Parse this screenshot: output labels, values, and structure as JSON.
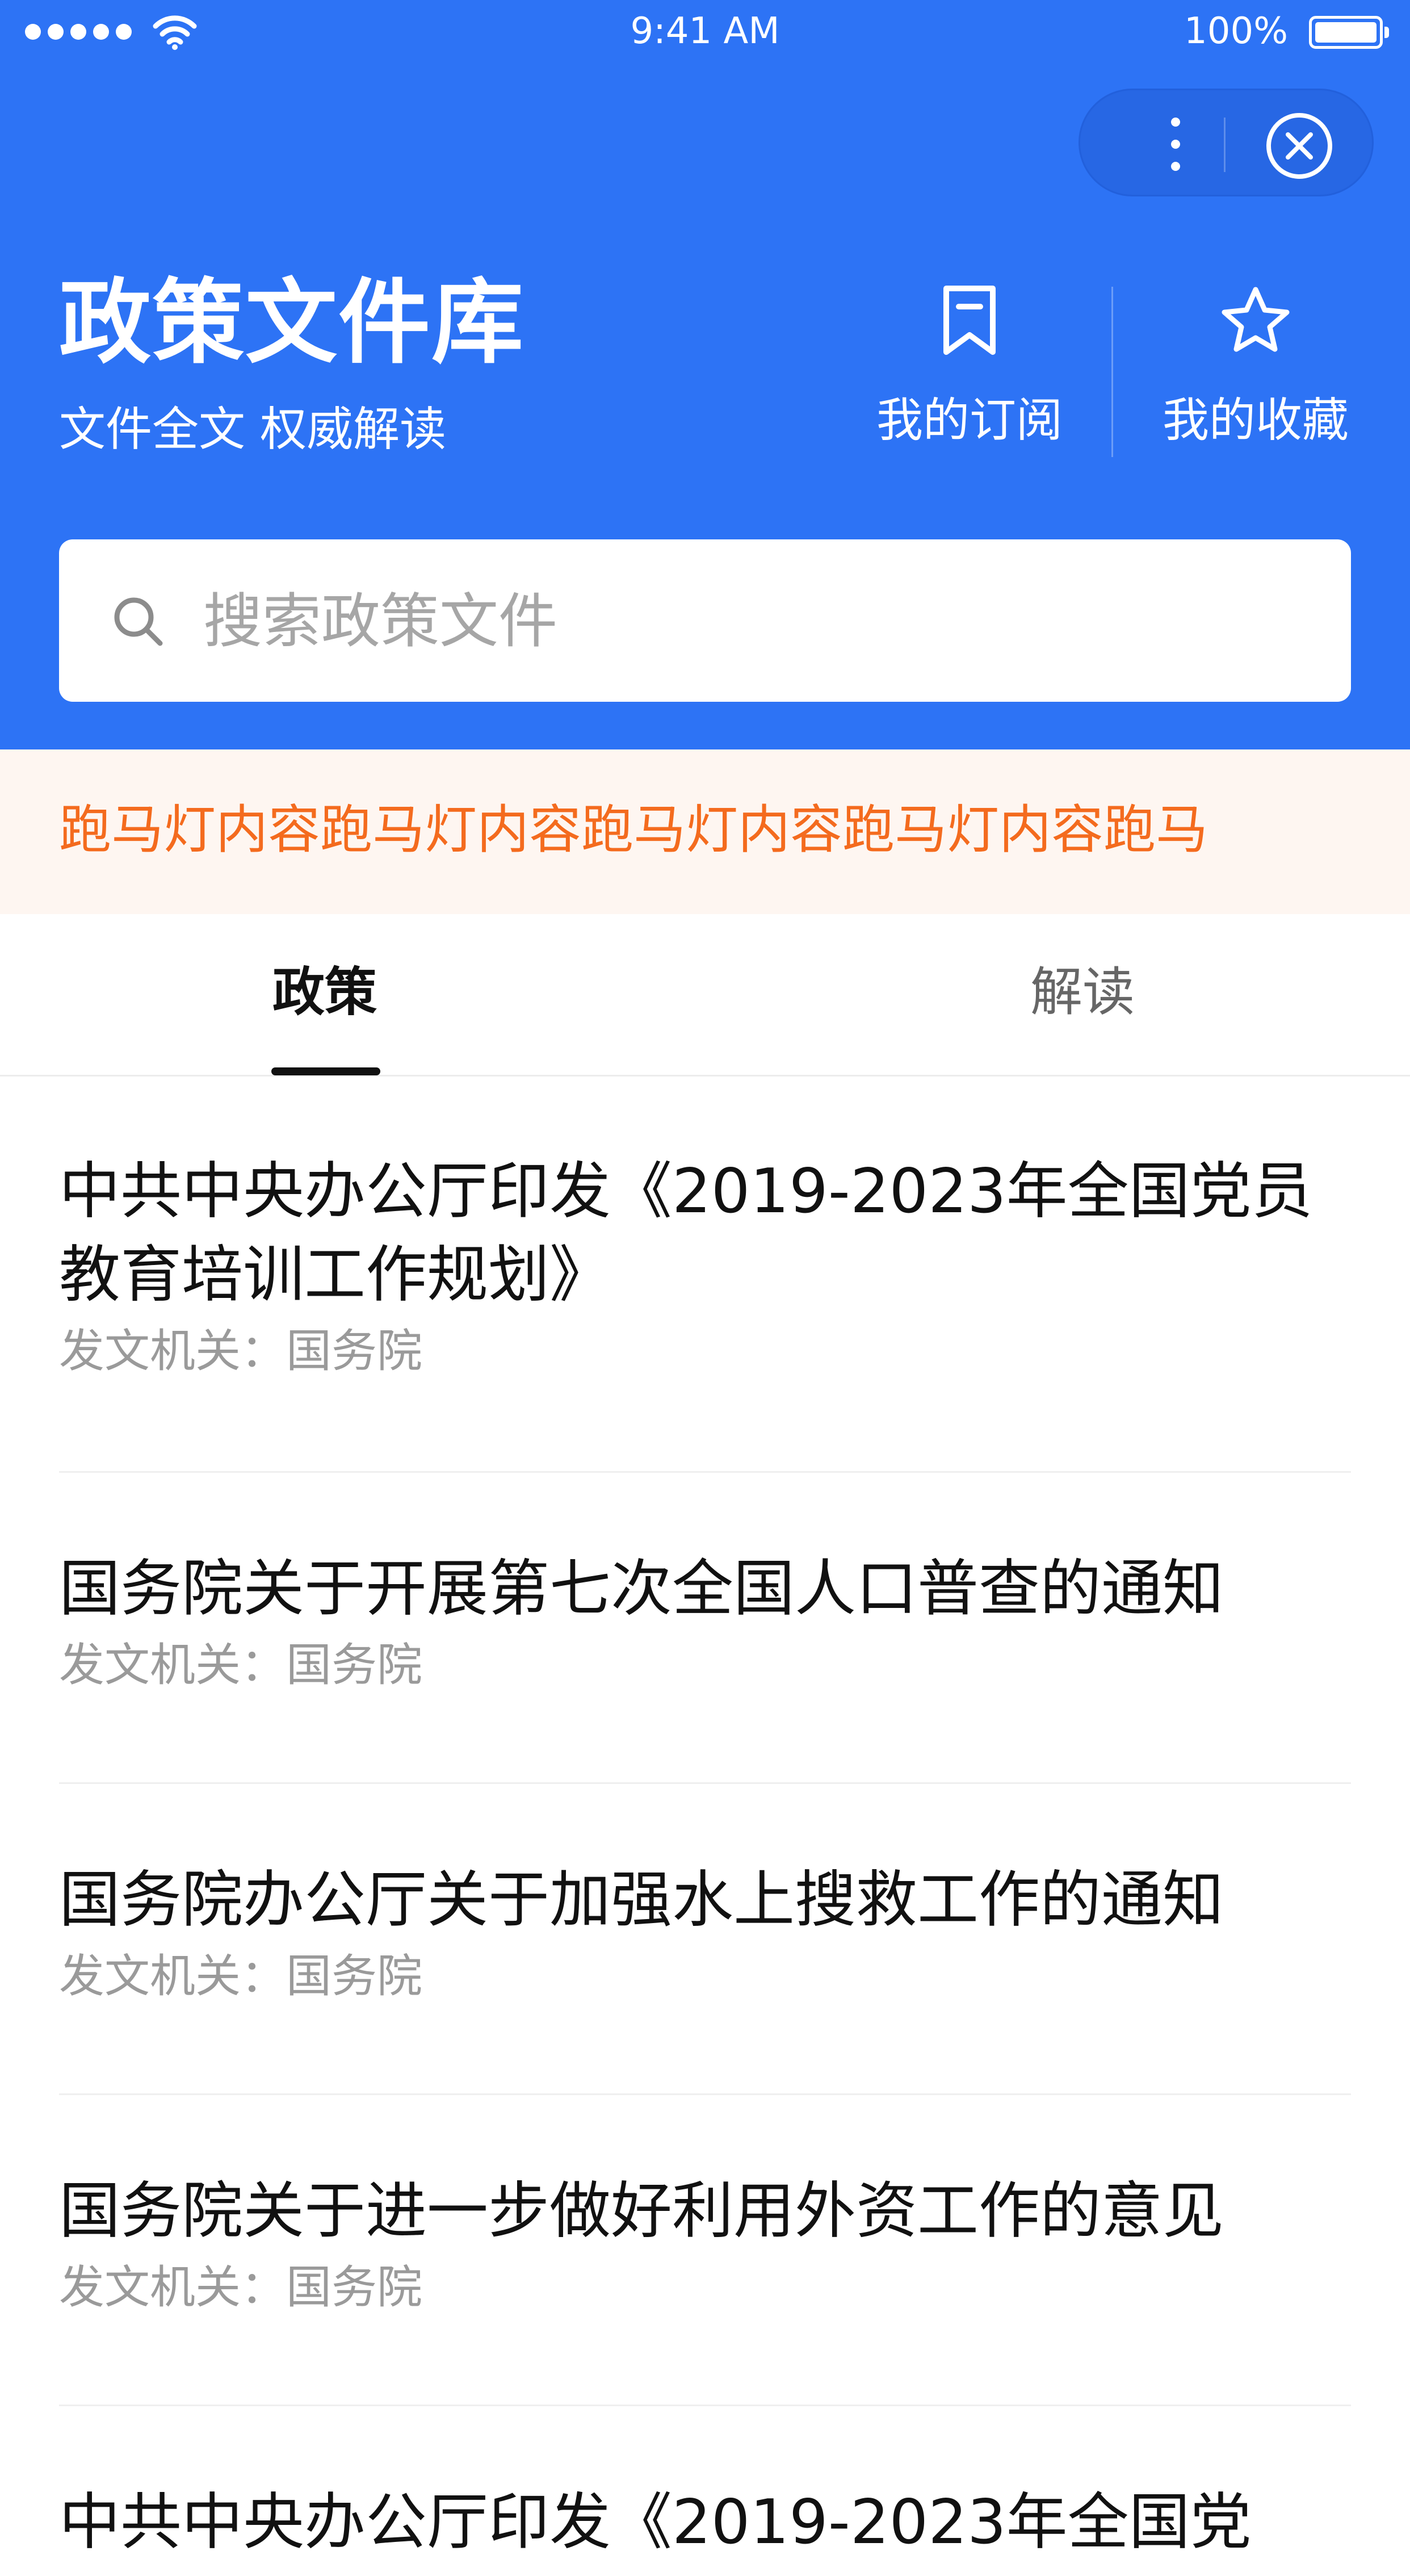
{
  "status_bar": {
    "time": "9:41 AM",
    "battery": "100%"
  },
  "header": {
    "title": "政策文件库",
    "subtitle": "文件全文 权威解读",
    "subscribe_label": "我的订阅",
    "favorites_label": "我的收藏",
    "brand_color": "#2d73f5"
  },
  "search": {
    "placeholder": "搜索政策文件"
  },
  "marquee": {
    "text": "跑马灯内容跑马灯内容跑马灯内容跑马灯内容跑马",
    "text_color": "#f46b1e"
  },
  "tabs": [
    {
      "label": "政策",
      "active": true
    },
    {
      "label": "解读",
      "active": false
    }
  ],
  "list": {
    "items": [
      {
        "title": "中共中央办公厅印发《2019-2023年全国党员教育培训工作规划》",
        "meta": "发文机关：国务院"
      },
      {
        "title": "国务院关于开展第七次全国人口普查的通知",
        "meta": "发文机关：国务院"
      },
      {
        "title": "国务院办公厅关于加强水上搜救工作的通知",
        "meta": "发文机关：国务院"
      },
      {
        "title": "国务院关于进一步做好利用外资工作的意见",
        "meta": "发文机关：国务院"
      },
      {
        "title": "中共中央办公厅印发《2019-2023年全国党",
        "meta": ""
      }
    ]
  }
}
